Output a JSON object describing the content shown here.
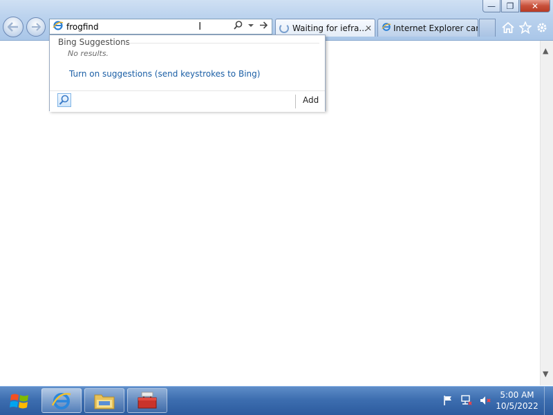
{
  "address_bar": {
    "value": "frogfind"
  },
  "tabs": [
    {
      "label": "Waiting for iefra...",
      "close_glyph": "✕",
      "state": "loading"
    },
    {
      "label": "Internet Explorer can...",
      "state": "inactive"
    }
  ],
  "window_controls": {
    "minimize": "—",
    "restore": "❐",
    "close": "✕"
  },
  "dropdown": {
    "header": "Bing Suggestions",
    "no_results": "No results.",
    "turn_on_link": "Turn on suggestions (send keystrokes to Bing)",
    "add_label": "Add"
  },
  "toolbar_icons": [
    "home-icon",
    "favorites-star-icon",
    "tools-gear-icon"
  ],
  "taskbar": {
    "time": "5:00 AM",
    "date": "10/5/2022",
    "pinned": [
      "internet-explorer-icon",
      "windows-explorer-icon",
      "toolbox-app-icon"
    ],
    "tray": [
      "action-center-flag-icon",
      "network-icon",
      "volume-muted-icon"
    ]
  },
  "colors": {
    "link": "#1a5ea5",
    "taskbar": "#3d6eb0",
    "close_button": "#c7503a"
  }
}
